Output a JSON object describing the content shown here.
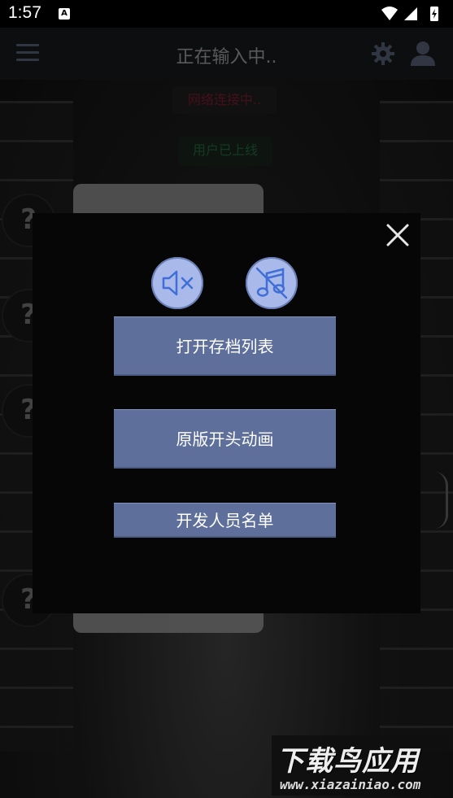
{
  "status_bar": {
    "time": "1:57",
    "notification_badge": "A"
  },
  "app_bar": {
    "title": "正在输入中.."
  },
  "toasts": {
    "network": "网络连接中..",
    "user_online": "用户已上线"
  },
  "side_buttons": [
    "?",
    "?",
    "?",
    "?"
  ],
  "modal": {
    "buttons": {
      "open_saves": "打开存档列表",
      "original_intro": "原版开头动画",
      "credits": "开发人员名单"
    },
    "toggle_icons": [
      "volume-mute-icon",
      "music-off-icon"
    ]
  },
  "watermark": {
    "title": "下载鸟应用",
    "url": "www.xiazainiao.com"
  },
  "colors": {
    "button_bg": "#5d6f9a",
    "round_button_bg": "#a9b9ea",
    "icon_blue": "#3f6fd6",
    "modal_bg": "#060606"
  }
}
